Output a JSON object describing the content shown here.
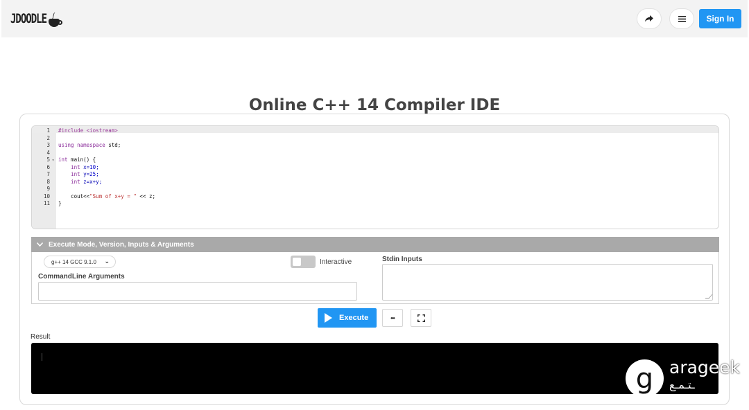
{
  "header": {
    "logo_text": "JDOODLE",
    "sign_in_label": "Sign In",
    "share_icon": "share-icon",
    "menu_icon": "hamburger-menu-icon"
  },
  "page": {
    "title": "Online C++ 14 Compiler IDE"
  },
  "editor": {
    "lines": [
      {
        "n": "1",
        "fold": "",
        "segments": [
          {
            "t": "#include <iostream>",
            "c": "pp"
          }
        ]
      },
      {
        "n": "2",
        "fold": "",
        "segments": []
      },
      {
        "n": "3",
        "fold": "",
        "segments": [
          {
            "t": "using namespace",
            "c": "kw"
          },
          {
            "t": " std;",
            "c": ""
          }
        ]
      },
      {
        "n": "4",
        "fold": "",
        "segments": []
      },
      {
        "n": "5",
        "fold": "▾",
        "segments": [
          {
            "t": "int",
            "c": "kw"
          },
          {
            "t": " main() {",
            "c": ""
          }
        ]
      },
      {
        "n": "6",
        "fold": "",
        "segments": [
          {
            "t": "    ",
            "c": ""
          },
          {
            "t": "int",
            "c": "kw"
          },
          {
            "t": " x=",
            "c": "ty"
          },
          {
            "t": "10",
            "c": "num"
          },
          {
            "t": ";",
            "c": "ty"
          }
        ]
      },
      {
        "n": "7",
        "fold": "",
        "segments": [
          {
            "t": "    ",
            "c": ""
          },
          {
            "t": "int",
            "c": "kw"
          },
          {
            "t": " y=",
            "c": "ty"
          },
          {
            "t": "25",
            "c": "num"
          },
          {
            "t": ";",
            "c": "ty"
          }
        ]
      },
      {
        "n": "8",
        "fold": "",
        "segments": [
          {
            "t": "    ",
            "c": ""
          },
          {
            "t": "int",
            "c": "kw"
          },
          {
            "t": " z=x+y;",
            "c": "ty"
          }
        ]
      },
      {
        "n": "9",
        "fold": "",
        "segments": []
      },
      {
        "n": "10",
        "fold": "",
        "segments": [
          {
            "t": "    cout<<",
            "c": ""
          },
          {
            "t": "\"Sum of x+y = \"",
            "c": "str"
          },
          {
            "t": " << z;",
            "c": ""
          }
        ]
      },
      {
        "n": "11",
        "fold": "",
        "segments": [
          {
            "t": "}",
            "c": ""
          }
        ]
      }
    ]
  },
  "execute_section": {
    "header_label": "Execute Mode, Version, Inputs & Arguments",
    "version_selected": "g++ 14 GCC 9.1.0",
    "interactive_label": "Interactive",
    "interactive_on": false,
    "cmd_args_label": "CommandLine Arguments",
    "cmd_args_value": "",
    "stdin_label": "Stdin Inputs",
    "stdin_value": ""
  },
  "actions": {
    "execute_label": "Execute",
    "more_label": "•••"
  },
  "result": {
    "label": "Result",
    "output": ""
  },
  "watermark": {
    "letter": "g",
    "text": "arageek",
    "sub": "ـتـمـع"
  },
  "colors": {
    "accent": "#2196f3",
    "header_bg": "#f3f3f3",
    "exec_header_bg": "#a9a9a9",
    "result_bg": "#000000"
  }
}
